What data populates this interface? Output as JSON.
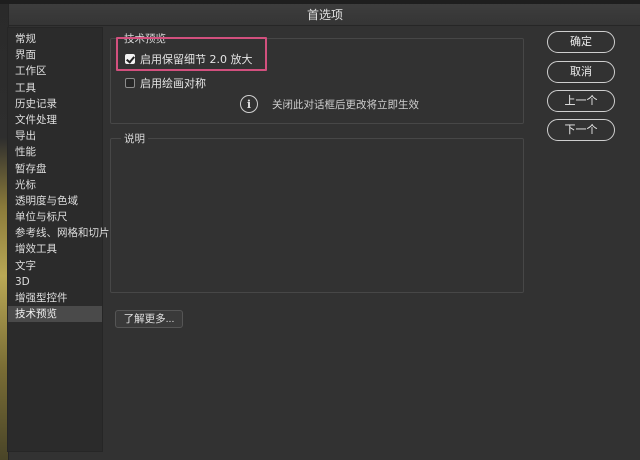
{
  "window": {
    "title": "首选项"
  },
  "sidebar": {
    "items": [
      {
        "label": "常规"
      },
      {
        "label": "界面"
      },
      {
        "label": "工作区"
      },
      {
        "label": "工具"
      },
      {
        "label": "历史记录"
      },
      {
        "label": "文件处理"
      },
      {
        "label": "导出"
      },
      {
        "label": "性能"
      },
      {
        "label": "暂存盘"
      },
      {
        "label": "光标"
      },
      {
        "label": "透明度与色域"
      },
      {
        "label": "单位与标尺"
      },
      {
        "label": "参考线、网格和切片"
      },
      {
        "label": "增效工具"
      },
      {
        "label": "文字"
      },
      {
        "label": "3D"
      },
      {
        "label": "增强型控件"
      },
      {
        "label": "技术预览",
        "selected": true
      }
    ]
  },
  "tech_preview": {
    "legend": "技术预览",
    "options": [
      {
        "label": "启用保留细节 2.0 放大",
        "checked": true
      },
      {
        "label": "启用绘画对称",
        "checked": false
      }
    ],
    "info_text": "关闭此对话框后更改将立即生效"
  },
  "description": {
    "legend": "说明"
  },
  "learn_more": {
    "label": "了解更多..."
  },
  "buttons": {
    "ok": "确定",
    "cancel": "取消",
    "prev": "上一个",
    "next": "下一个"
  },
  "colors": {
    "highlight_border": "#d2507e",
    "dialog_bg": "#323232"
  },
  "icons": {
    "info": "info-icon"
  }
}
